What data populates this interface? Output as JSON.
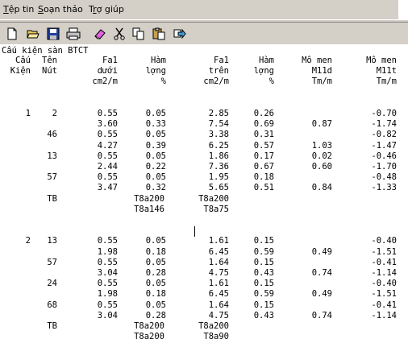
{
  "menu": [
    {
      "pre": "",
      "acc": "T",
      "post": "ệp tin"
    },
    {
      "pre": "",
      "acc": "S",
      "post": "oạn thảo"
    },
    {
      "pre": "T",
      "acc": "r",
      "post": "ợ giúp"
    }
  ],
  "toolbar": {
    "icons": [
      "new-document-icon",
      "open-folder-icon",
      "save-disk-icon",
      "print-icon",
      "eraser-icon",
      "cut-scissors-icon",
      "copy-icon",
      "paste-icon",
      "forward-arrow-icon"
    ]
  },
  "document": {
    "title": "Cấu kiện sàn BTCT",
    "header": {
      "col1": [
        "Cấu",
        "Kiện"
      ],
      "col2": [
        "Tên",
        "Nút"
      ],
      "col3": [
        "Fa1",
        "dưới",
        "cm2/m"
      ],
      "col4": [
        "Hàm",
        "lợng",
        "%"
      ],
      "col5": [
        "Fa1",
        "trên",
        "cm2/m"
      ],
      "col6": [
        "Hàm",
        "lợng",
        "%"
      ],
      "col7": [
        "Mô men",
        "M11d",
        "Tm/m"
      ],
      "col8": [
        "Mô men",
        "M11t",
        "Tm/m"
      ]
    },
    "sections": [
      {
        "cau_kien": "1",
        "rows": [
          {
            "nut": "2",
            "fa_duoi": "0.55",
            "ham_luong_1": "0.05",
            "fa_tren": "2.85",
            "ham_luong_2": "0.26",
            "m11d": "",
            "m11t": "-0.70"
          },
          {
            "nut": "",
            "fa_duoi": "3.60",
            "ham_luong_1": "0.33",
            "fa_tren": "7.54",
            "ham_luong_2": "0.69",
            "m11d": "0.87",
            "m11t": "-1.74"
          },
          {
            "nut": "46",
            "fa_duoi": "0.55",
            "ham_luong_1": "0.05",
            "fa_tren": "3.38",
            "ham_luong_2": "0.31",
            "m11d": "",
            "m11t": "-0.82"
          },
          {
            "nut": "",
            "fa_duoi": "4.27",
            "ham_luong_1": "0.39",
            "fa_tren": "6.25",
            "ham_luong_2": "0.57",
            "m11d": "1.03",
            "m11t": "-1.47"
          },
          {
            "nut": "13",
            "fa_duoi": "0.55",
            "ham_luong_1": "0.05",
            "fa_tren": "1.86",
            "ham_luong_2": "0.17",
            "m11d": "0.02",
            "m11t": "-0.46"
          },
          {
            "nut": "",
            "fa_duoi": "2.44",
            "ham_luong_1": "0.22",
            "fa_tren": "7.36",
            "ham_luong_2": "0.67",
            "m11d": "0.60",
            "m11t": "-1.70"
          },
          {
            "nut": "57",
            "fa_duoi": "0.55",
            "ham_luong_1": "0.05",
            "fa_tren": "1.95",
            "ham_luong_2": "0.18",
            "m11d": "",
            "m11t": "-0.48"
          },
          {
            "nut": "",
            "fa_duoi": "3.47",
            "ham_luong_1": "0.32",
            "fa_tren": "5.65",
            "ham_luong_2": "0.51",
            "m11d": "0.84",
            "m11t": "-1.33"
          }
        ],
        "tb": {
          "label": "TB",
          "duoi": [
            "T8a200",
            "T8a146"
          ],
          "tren": [
            "T8a200",
            "T8a75"
          ]
        }
      },
      {
        "cau_kien": "2",
        "rows": [
          {
            "nut": "13",
            "fa_duoi": "0.55",
            "ham_luong_1": "0.05",
            "fa_tren": "1.61",
            "ham_luong_2": "0.15",
            "m11d": "",
            "m11t": "-0.40"
          },
          {
            "nut": "",
            "fa_duoi": "1.98",
            "ham_luong_1": "0.18",
            "fa_tren": "6.45",
            "ham_luong_2": "0.59",
            "m11d": "0.49",
            "m11t": "-1.51"
          },
          {
            "nut": "57",
            "fa_duoi": "0.55",
            "ham_luong_1": "0.05",
            "fa_tren": "1.64",
            "ham_luong_2": "0.15",
            "m11d": "",
            "m11t": "-0.41"
          },
          {
            "nut": "",
            "fa_duoi": "3.04",
            "ham_luong_1": "0.28",
            "fa_tren": "4.75",
            "ham_luong_2": "0.43",
            "m11d": "0.74",
            "m11t": "-1.14"
          },
          {
            "nut": "24",
            "fa_duoi": "0.55",
            "ham_luong_1": "0.05",
            "fa_tren": "1.61",
            "ham_luong_2": "0.15",
            "m11d": "",
            "m11t": "-0.40"
          },
          {
            "nut": "",
            "fa_duoi": "1.98",
            "ham_luong_1": "0.18",
            "fa_tren": "6.45",
            "ham_luong_2": "0.59",
            "m11d": "0.49",
            "m11t": "-1.51"
          },
          {
            "nut": "68",
            "fa_duoi": "0.55",
            "ham_luong_1": "0.05",
            "fa_tren": "1.64",
            "ham_luong_2": "0.15",
            "m11d": "",
            "m11t": "-0.41"
          },
          {
            "nut": "",
            "fa_duoi": "3.04",
            "ham_luong_1": "0.28",
            "fa_tren": "4.75",
            "ham_luong_2": "0.43",
            "m11d": "0.74",
            "m11t": "-1.14"
          }
        ],
        "tb": {
          "label": "TB",
          "duoi": [
            "T8a200",
            "T8a200"
          ],
          "tren": [
            "T8a200",
            "T8a90"
          ]
        }
      }
    ]
  }
}
